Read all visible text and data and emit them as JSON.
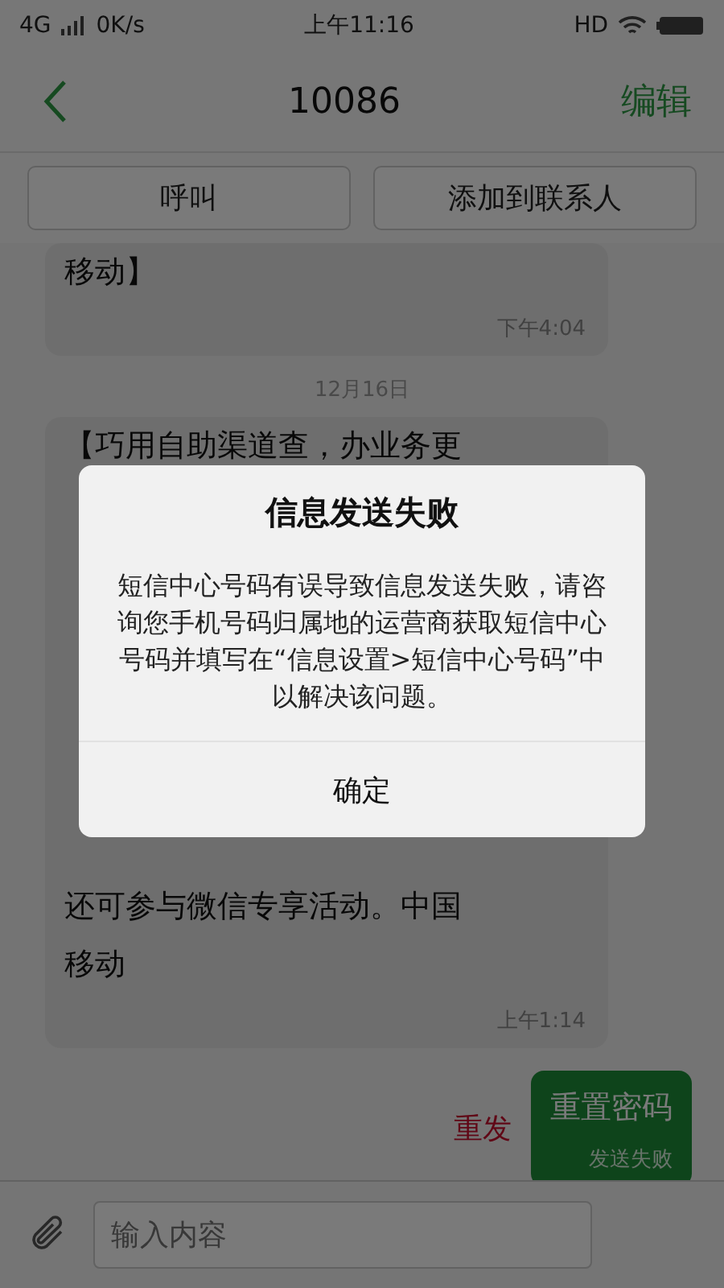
{
  "status_bar": {
    "network": "4G",
    "speed": "0K/s",
    "time": "上午11:16",
    "hd": "HD"
  },
  "header": {
    "title": "10086",
    "edit": "编辑"
  },
  "actions": [
    "呼叫",
    "添加到联系人"
  ],
  "messages": [
    {
      "kind": "received",
      "lines": [
        "移动】"
      ],
      "time": "下午4:04"
    },
    {
      "kind": "date",
      "text": "12月16日"
    },
    {
      "kind": "received",
      "lines": [
        "【巧用自助渠道查，办业务更"
      ],
      "lines_after": [
        "还可参与微信专享活动。中国",
        "移动"
      ],
      "time": "上午1:14"
    },
    {
      "kind": "sent",
      "text": "重置密码",
      "status": "发送失败",
      "resend": "重发"
    }
  ],
  "composer": {
    "placeholder": "输入内容"
  },
  "dialog": {
    "title": "信息发送失败",
    "body": "短信中心号码有误导致信息发送失败，请咨询您手机号码归属地的运营商获取短信中心号码并填写在“信息设置>短信中心号码”中以解决该问题。",
    "button": "确定"
  }
}
